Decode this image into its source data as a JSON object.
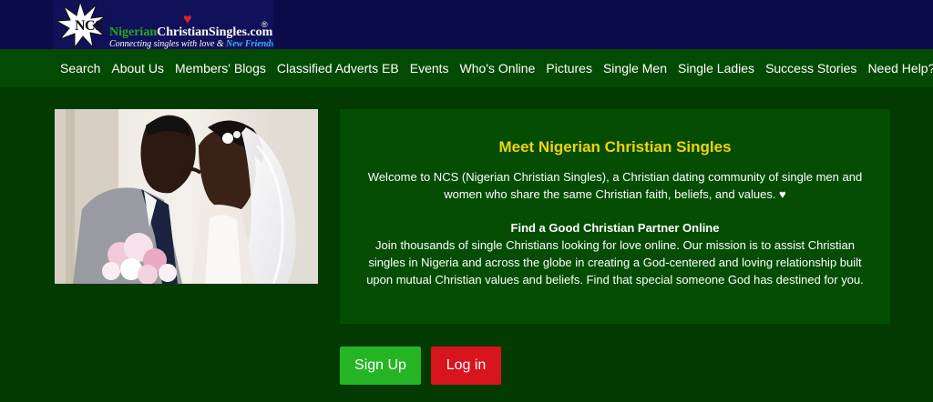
{
  "logo": {
    "initials": "NCS",
    "site_part1": "Nigerian",
    "site_part2": "ChristianSingles",
    "site_part3": ".com",
    "registered": "®",
    "tagline": "Connecting singles with love & ",
    "tagline_highlight": "New Friends"
  },
  "nav": {
    "items": [
      "Search",
      "About Us",
      "Members' Blogs",
      "Classified Adverts EB",
      "Events",
      "Who's Online",
      "Pictures",
      "Single Men",
      "Single Ladies",
      "Success Stories",
      "Need Help?"
    ]
  },
  "intro": {
    "title": "Meet Nigerian Christian Singles",
    "welcome": "Welcome to NCS (Nigerian Christian Singles), a Christian dating community of single men and women who share the same Christian faith, beliefs, and values. ♥",
    "subheading": "Find a Good Christian Partner Online",
    "body": "Join thousands of single Christians looking for love online. Our mission is to assist Christian singles in Nigeria and across the globe in creating a God-centered and loving relationship built upon mutual Christian values and beliefs. Find that special someone God has destined for you."
  },
  "actions": {
    "signup_label": "Sign Up",
    "login_label": "Log in"
  },
  "colors": {
    "page_bg": "#033a02",
    "nav_bg": "#044a03",
    "header_bg": "#0b0b4a",
    "title_yellow": "#f2d20a",
    "signup_green": "#25b524",
    "login_red": "#d8141d"
  },
  "icons": {
    "logo_star": "star-burst-icon",
    "logo_heart": "heart-icon"
  }
}
